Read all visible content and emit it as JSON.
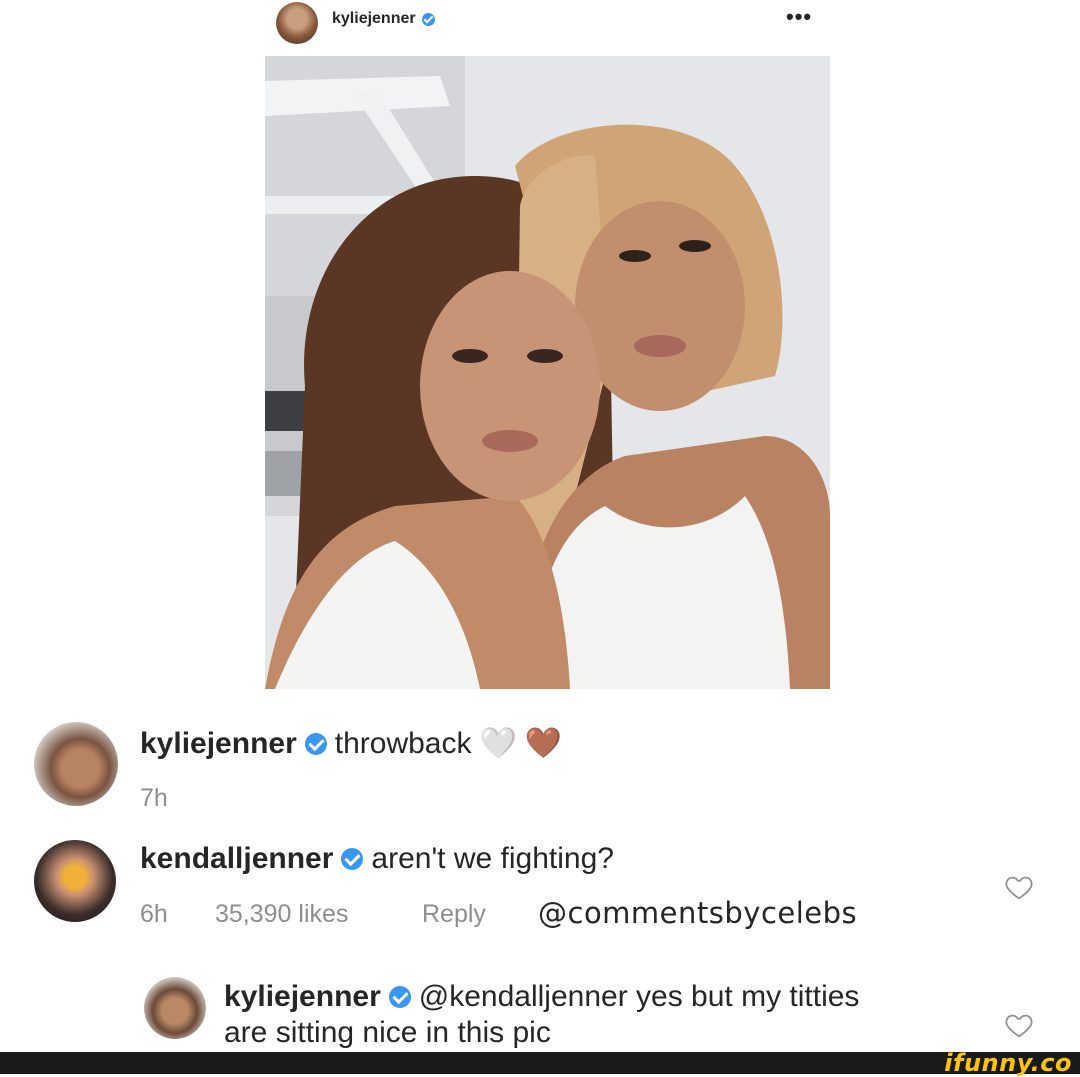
{
  "post": {
    "username": "kyliejenner",
    "more_label": "•••"
  },
  "comments": [
    {
      "username": "kyliejenner",
      "text": "throwback",
      "emoji_white": "🤍",
      "emoji_brown": "🤎",
      "time": "7h"
    },
    {
      "username": "kendalljenner",
      "text": "aren't we fighting?",
      "time": "6h",
      "likes": "35,390 likes",
      "reply": "Reply",
      "watermark": "@commentsbycelebs"
    },
    {
      "username": "kyliejenner",
      "text_line1": "@kendalljenner yes but my titties",
      "text_line2": "are sitting nice in this pic"
    }
  ],
  "footer": {
    "brand": "ifunny.co"
  },
  "colors": {
    "verified": "#3897f0",
    "meta_gray": "#8e8e8e",
    "ifunny_yellow": "#ffc40a"
  }
}
